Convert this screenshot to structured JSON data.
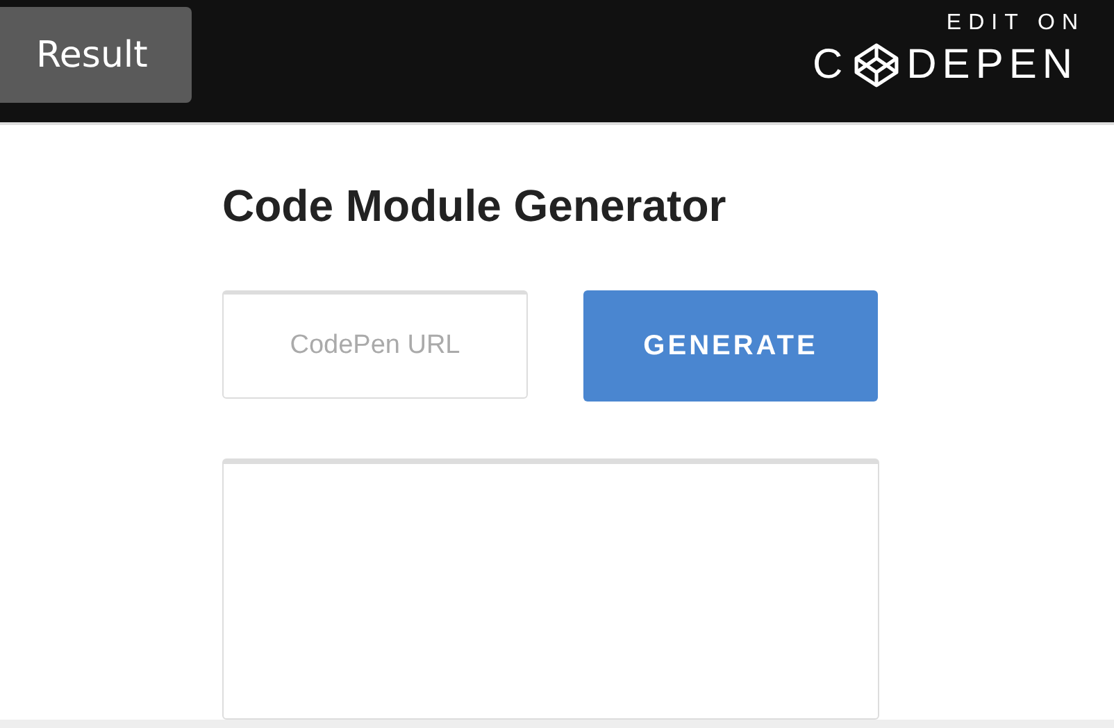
{
  "top_bar": {
    "tab": {
      "label": "Result",
      "selected": true
    },
    "edit_on": "EDIT ON",
    "logo": {
      "before": "C",
      "after": "DEPEN"
    }
  },
  "title": "Code Module Generator",
  "url_field": {
    "placeholder": "CodePen URL"
  },
  "generate_button": "GENERATE"
}
